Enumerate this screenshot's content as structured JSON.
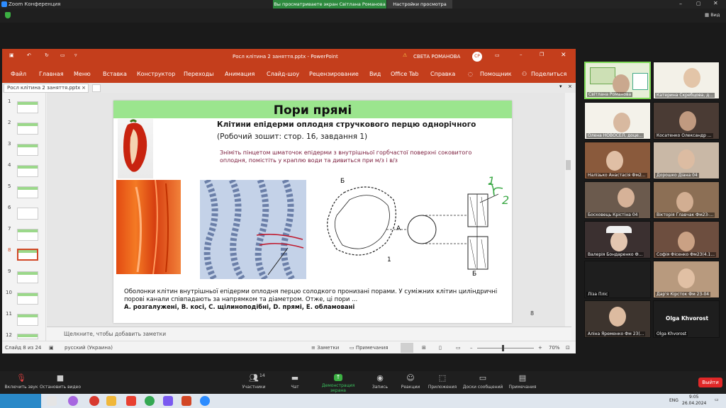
{
  "zoom": {
    "window_title": "Zoom Конференция",
    "share_banner": "Вы просматриваете экран Світлана Романова",
    "view_options": "Настройки просмотра",
    "view_button": "Вид",
    "toolbar": {
      "mute": "Включить звук",
      "video": "Остановить видео",
      "participants": "Участники",
      "participants_count": "14",
      "chat": "Чат",
      "share": "Демонстрация экрана",
      "record": "Запись",
      "reactions": "Реакции",
      "apps": "Приложения",
      "boards": "Доски сообщений",
      "notes": "Примечания",
      "leave": "Выйти"
    },
    "participants": [
      {
        "name": "Світлана Романова"
      },
      {
        "name": "Катерина Скребцова, д..."
      },
      {
        "name": "Олена НОВОСЕЛ, доце..."
      },
      {
        "name": "Косатенко Олександр ..."
      },
      {
        "name": "Налізько Анастасія Фм2..."
      },
      {
        "name": "Дорошко Діана 04"
      },
      {
        "name": "Босковець Крістіна 04"
      },
      {
        "name": "Вікторія Главчак Фм23-..."
      },
      {
        "name": "Валерія Бондаренко Ф..."
      },
      {
        "name": "Софія Фісенко Фм23(4.1..."
      },
      {
        "name": "Ліза Пліс"
      },
      {
        "name": "Дар'я Кірсток Фм 23-04"
      },
      {
        "name": "Аліна Яременко Фм 23(..."
      },
      {
        "name": "Olga Khvorost",
        "center_label": "Olga Khvorost"
      }
    ]
  },
  "ppt": {
    "window_title": "Росл клітина 2 заняття.pptx  -  PowerPoint",
    "warning": "⚠",
    "user_name": "СВЕТА РОМАНОВА",
    "user_initials": "СР",
    "menu": [
      "Файл",
      "Главная",
      "Меню",
      "Вставка",
      "Конструктор",
      "Переходы",
      "Анимация",
      "Слайд-шоу",
      "Рецензирование",
      "Вид",
      "Office Tab",
      "Справка",
      "Помощник",
      "Поделиться"
    ],
    "doc_tab": "Росл клітина 2 заняття.pptx",
    "slide_numbers": [
      "1",
      "2",
      "3",
      "4",
      "5",
      "6",
      "7",
      "8",
      "9",
      "10",
      "11",
      "12"
    ],
    "active_slide": 8,
    "notes_placeholder": "Щелкните, чтобы добавить заметки",
    "status": {
      "slide_info": "Слайд 8 из 24",
      "language": "русский (Украина)",
      "notes": "Заметки",
      "comments": "Примечания",
      "zoom": "70%"
    },
    "slide": {
      "title": "Пори прямі",
      "subtitle": "Клітини епідерми оплодня стручкового перцю однорічного",
      "reference": "(Робочий зошит: стор. 16,  завдання 1)",
      "instruction": "Зніміть пінцетом шматочок епідерми з внутрішньої горбчастої поверхні соковитого оплодня, помістіть у краплю води та дивиться при м/з і в/з",
      "bottom_text": "Оболонки клітин внутрішньої епідерми оплодня перцю солодкого пронизані порами. У суміжних клітин циліндричні порові канали співпадають за напрямком та діаметром. Отже, ці пори ...",
      "answers": "А. розгалужені,  В.  косі,  С.  щілиноподібні,  D. прямі,  Е.  обламовані",
      "page_number": "8",
      "diagram_labels": {
        "b_top": "Б",
        "a": "А",
        "one": "1",
        "b_bottom": "Б"
      },
      "handwritten": {
        "one": "1",
        "two": "2"
      }
    }
  },
  "taskbar": {
    "lang": "ENG",
    "time": "9:05",
    "date": "26.04.2024"
  },
  "colors": {
    "ppt_red": "#c43e1c",
    "slide_banner": "#9be58e",
    "zoom_green": "#2d8a3e",
    "leave_red": "#e02828"
  }
}
